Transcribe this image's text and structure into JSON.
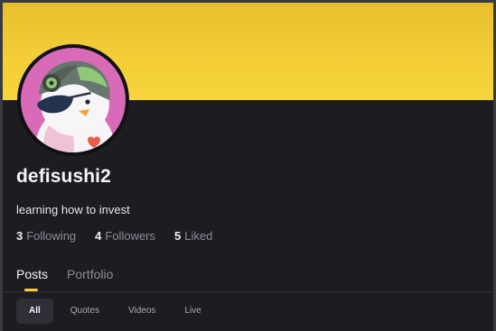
{
  "profile": {
    "username": "defisushi2",
    "bio": "learning how to invest"
  },
  "stats": [
    {
      "count": "3",
      "label": "Following"
    },
    {
      "count": "4",
      "label": "Followers"
    },
    {
      "count": "5",
      "label": "Liked"
    }
  ],
  "tabs": [
    {
      "label": "Posts",
      "active": true
    },
    {
      "label": "Portfolio",
      "active": false
    }
  ],
  "filters": [
    {
      "label": "All",
      "active": true
    },
    {
      "label": "Quotes",
      "active": false
    },
    {
      "label": "Videos",
      "active": false
    },
    {
      "label": "Live",
      "active": false
    }
  ],
  "colors": {
    "banner": "#f3ce37",
    "background": "#1c1c21",
    "accent": "#f5cd35",
    "muted_text": "#8b8d98"
  },
  "avatar": {
    "icon": "penguin-avatar-icon"
  }
}
